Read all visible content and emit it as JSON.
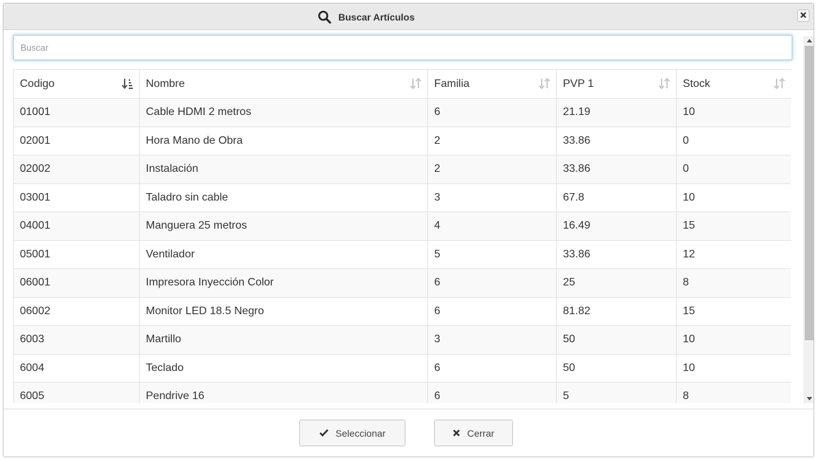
{
  "dialog": {
    "title": "Buscar Artículos",
    "title_icon": "search-icon",
    "close_icon": "close-icon"
  },
  "search": {
    "placeholder": "Buscar",
    "value": ""
  },
  "table": {
    "columns": [
      {
        "label": "Codigo",
        "sort": "ascending"
      },
      {
        "label": "Nombre",
        "sort": "none"
      },
      {
        "label": "Familia",
        "sort": "none"
      },
      {
        "label": "PVP 1",
        "sort": "none"
      },
      {
        "label": "Stock",
        "sort": "none"
      }
    ],
    "rows": [
      [
        "01001",
        "Cable HDMI 2 metros",
        "6",
        "21.19",
        "10"
      ],
      [
        "02001",
        "Hora Mano de Obra",
        "2",
        "33.86",
        "0"
      ],
      [
        "02002",
        "Instalación",
        "2",
        "33.86",
        "0"
      ],
      [
        "03001",
        "Taladro sin cable",
        "3",
        "67.8",
        "10"
      ],
      [
        "04001",
        "Manguera 25 metros",
        "4",
        "16.49",
        "15"
      ],
      [
        "05001",
        "Ventilador",
        "5",
        "33.86",
        "12"
      ],
      [
        "06001",
        "Impresora Inyección Color",
        "6",
        "25",
        "8"
      ],
      [
        "06002",
        "Monitor LED 18.5 Negro",
        "6",
        "81.82",
        "15"
      ],
      [
        "6003",
        "Martillo",
        "3",
        "50",
        "10"
      ],
      [
        "6004",
        "Teclado",
        "6",
        "50",
        "10"
      ],
      [
        "6005",
        "Pendrive 16",
        "6",
        "5",
        "8"
      ]
    ]
  },
  "buttons": {
    "select_label": "Seleccionar",
    "select_icon": "check-icon",
    "close_label": "Cerrar",
    "close_icon": "close-icon"
  },
  "colors": {
    "titlebar_bg": "#e9e9e9",
    "row_alt_bg": "#f9f9f9",
    "focus_border": "#9ecaed",
    "button_bg": "#f6f6f6"
  }
}
